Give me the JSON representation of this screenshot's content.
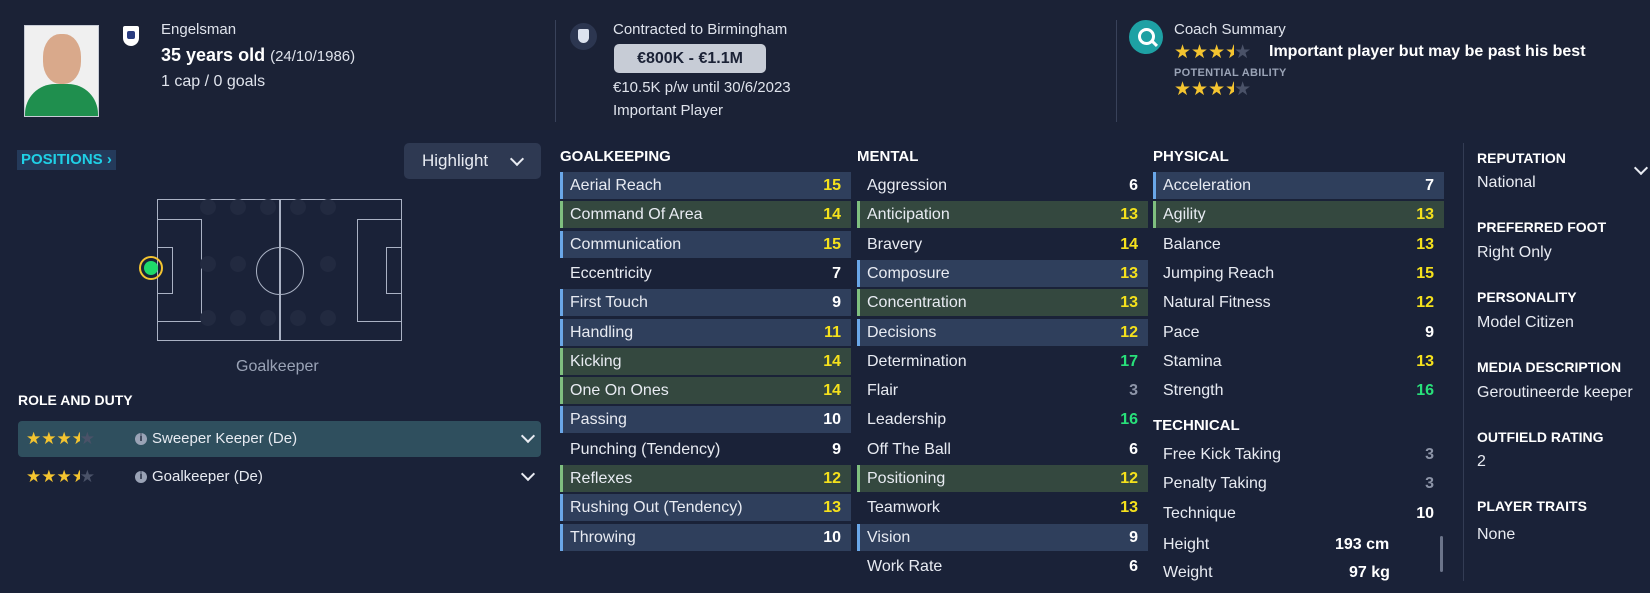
{
  "header": {
    "nationality": "Engelsman",
    "age": "35 years old",
    "dob": "(24/10/1986)",
    "caps": "1 cap / 0 goals",
    "contract": "Contracted to Birmingham",
    "value": "€800K - €1.1M",
    "wage": "€10.5K p/w until 30/6/2023",
    "squad_status": "Important Player",
    "coach_title": "Coach Summary",
    "coach_summary": "Important player but may be past his best",
    "current_ability_stars": 3.5,
    "potential_label": "POTENTIAL ABILITY",
    "potential_ability_stars": 3.5
  },
  "positions": {
    "label": "POSITIONS",
    "highlight_label": "Highlight",
    "position_name": "Goalkeeper"
  },
  "roles": {
    "title": "ROLE AND DUTY",
    "items": [
      {
        "label": "Sweeper Keeper (De)",
        "stars": 3.5,
        "selected": true
      },
      {
        "label": "Goalkeeper (De)",
        "stars": 3.5,
        "selected": false
      }
    ]
  },
  "goalkeeping": {
    "title": "GOALKEEPING",
    "attrs": [
      {
        "name": "Aerial Reach",
        "value": "15"
      },
      {
        "name": "Command Of Area",
        "value": "14"
      },
      {
        "name": "Communication",
        "value": "15"
      },
      {
        "name": "Eccentricity",
        "value": "7"
      },
      {
        "name": "First Touch",
        "value": "9"
      },
      {
        "name": "Handling",
        "value": "11"
      },
      {
        "name": "Kicking",
        "value": "14"
      },
      {
        "name": "One On Ones",
        "value": "14"
      },
      {
        "name": "Passing",
        "value": "10"
      },
      {
        "name": "Punching (Tendency)",
        "value": "9"
      },
      {
        "name": "Reflexes",
        "value": "12"
      },
      {
        "name": "Rushing Out (Tendency)",
        "value": "13"
      },
      {
        "name": "Throwing",
        "value": "10"
      }
    ]
  },
  "mental": {
    "title": "MENTAL",
    "attrs": [
      {
        "name": "Aggression",
        "value": "6"
      },
      {
        "name": "Anticipation",
        "value": "13"
      },
      {
        "name": "Bravery",
        "value": "14"
      },
      {
        "name": "Composure",
        "value": "13"
      },
      {
        "name": "Concentration",
        "value": "13"
      },
      {
        "name": "Decisions",
        "value": "12"
      },
      {
        "name": "Determination",
        "value": "17"
      },
      {
        "name": "Flair",
        "value": "3"
      },
      {
        "name": "Leadership",
        "value": "16"
      },
      {
        "name": "Off The Ball",
        "value": "6"
      },
      {
        "name": "Positioning",
        "value": "12"
      },
      {
        "name": "Teamwork",
        "value": "13"
      },
      {
        "name": "Vision",
        "value": "9"
      },
      {
        "name": "Work Rate",
        "value": "6"
      }
    ]
  },
  "physical": {
    "title": "PHYSICAL",
    "attrs": [
      {
        "name": "Acceleration",
        "value": "7"
      },
      {
        "name": "Agility",
        "value": "13"
      },
      {
        "name": "Balance",
        "value": "13"
      },
      {
        "name": "Jumping Reach",
        "value": "15"
      },
      {
        "name": "Natural Fitness",
        "value": "12"
      },
      {
        "name": "Pace",
        "value": "9"
      },
      {
        "name": "Stamina",
        "value": "13"
      },
      {
        "name": "Strength",
        "value": "16"
      }
    ]
  },
  "technical": {
    "title": "TECHNICAL",
    "attrs": [
      {
        "name": "Free Kick Taking",
        "value": "3"
      },
      {
        "name": "Penalty Taking",
        "value": "3"
      },
      {
        "name": "Technique",
        "value": "10"
      }
    ],
    "height_label": "Height",
    "height": "193 cm",
    "weight_label": "Weight",
    "weight": "97 kg"
  },
  "info": {
    "reputation_label": "REPUTATION",
    "reputation": "National",
    "foot_label": "PREFERRED FOOT",
    "foot": "Right Only",
    "personality_label": "PERSONALITY",
    "personality": "Model Citizen",
    "media_label": "MEDIA DESCRIPTION",
    "media": "Geroutineerde keeper",
    "outfield_label": "OUTFIELD RATING",
    "outfield": "2",
    "traits_label": "PLAYER TRAITS",
    "traits": "None"
  }
}
